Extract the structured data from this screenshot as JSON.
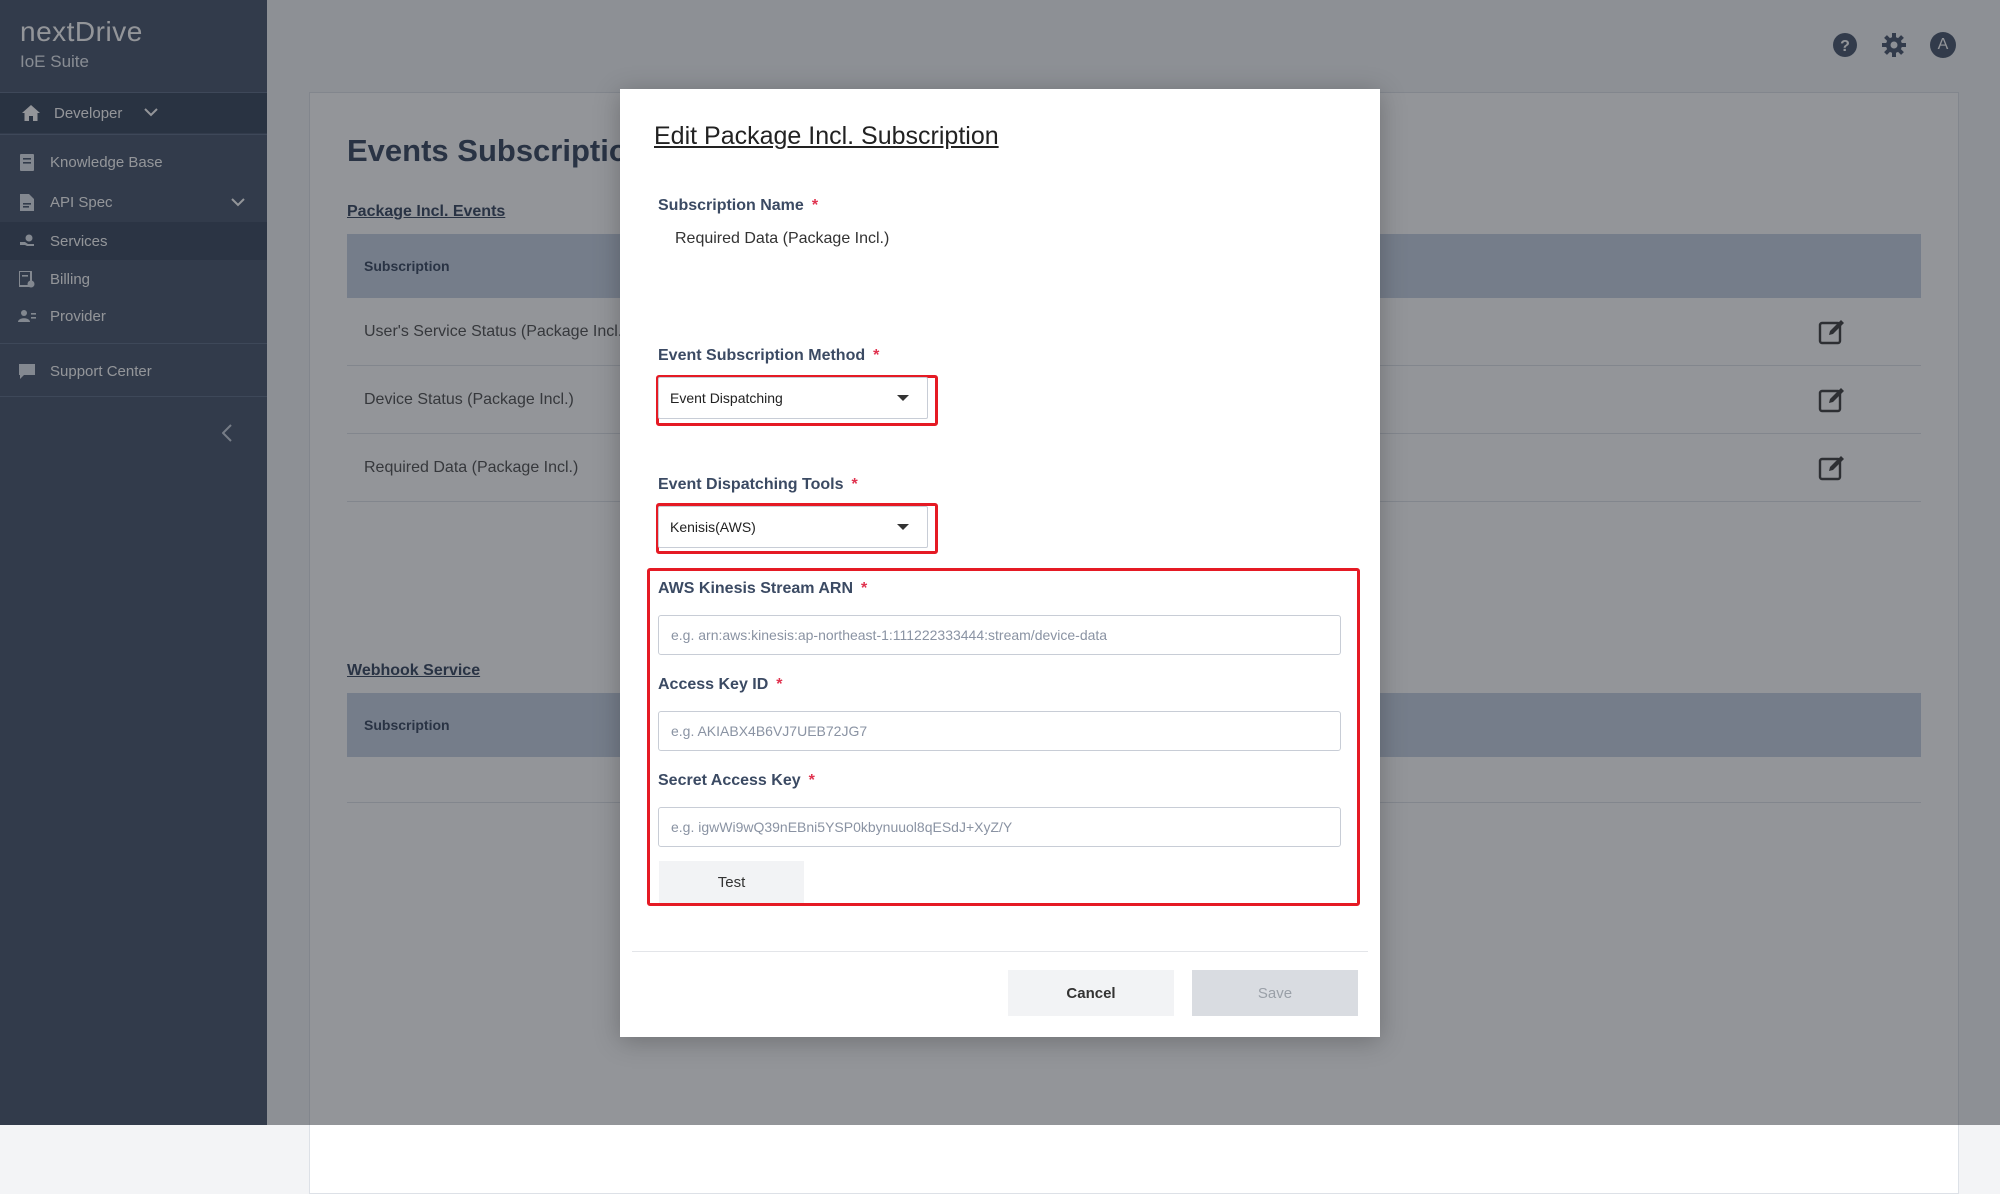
{
  "brand": {
    "name": "nextDrive",
    "subtitle": "IoE Suite"
  },
  "sidebar": {
    "workspace": {
      "label": "Developer"
    },
    "items": [
      {
        "label": "Knowledge Base",
        "icon": "book-icon"
      },
      {
        "label": "API Spec",
        "icon": "document-icon"
      },
      {
        "label": "Services",
        "icon": "services-icon",
        "active": true
      },
      {
        "label": "Billing",
        "icon": "billing-icon"
      },
      {
        "label": "Provider",
        "icon": "provider-icon"
      }
    ],
    "support": {
      "label": "Support Center"
    }
  },
  "topbar": {
    "avatar_letter": "A"
  },
  "main": {
    "title": "Events Subscription",
    "package_section": "Package Incl. Events",
    "package_header": "Subscription",
    "package_rows": [
      "User's Service Status (Package Incl.)",
      "Device Status (Package Incl.)",
      "Required Data (Package Incl.)"
    ],
    "webhook_section": "Webhook Service",
    "webhook_header": "Subscription"
  },
  "modal": {
    "title": "Edit Package Incl. Subscription",
    "subscription_name_label": "Subscription Name",
    "subscription_name_value": "Required Data (Package Incl.)",
    "method_label": "Event Subscription Method",
    "method_value": "Event Dispatching",
    "tools_label": "Event Dispatching Tools",
    "tools_value": "Kenisis(AWS)",
    "arn_label": "AWS Kinesis Stream ARN",
    "arn_placeholder": "e.g. arn:aws:kinesis:ap-northeast-1:111222333444:stream/device-data",
    "access_key_label": "Access Key ID",
    "access_key_placeholder": "e.g. AKIABX4B6VJ7UEB72JG7",
    "secret_key_label": "Secret Access Key",
    "secret_key_placeholder": "e.g. igwWi9wQ39nEBni5YSP0kbynuuol8qESdJ+XyZ/Y",
    "required_mark": "*",
    "test_label": "Test",
    "cancel_label": "Cancel",
    "save_label": "Save"
  },
  "colors": {
    "sidebar": "#3c4b63",
    "highlight": "#e51a24",
    "required": "#e0334f",
    "table_header": "#c3cfe0"
  }
}
